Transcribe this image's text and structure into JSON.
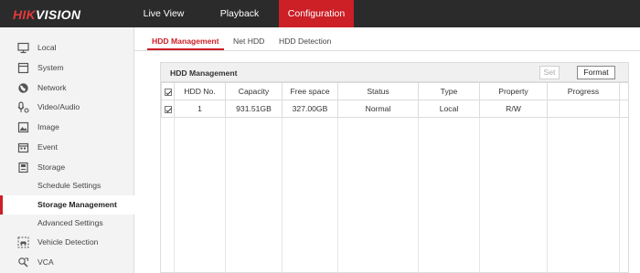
{
  "app": {
    "logo": {
      "part1": "HIK",
      "part2": "VISION"
    }
  },
  "nav": {
    "live_view": "Live View",
    "playback": "Playback",
    "configuration": "Configuration"
  },
  "sidebar": {
    "items": [
      {
        "label": "Local",
        "icon": "monitor-icon"
      },
      {
        "label": "System",
        "icon": "system-icon"
      },
      {
        "label": "Network",
        "icon": "network-globe-icon"
      },
      {
        "label": "Video/Audio",
        "icon": "microphone-icon"
      },
      {
        "label": "Image",
        "icon": "image-icon"
      },
      {
        "label": "Event",
        "icon": "calendar-icon"
      },
      {
        "label": "Storage",
        "icon": "storage-icon"
      }
    ],
    "storage_sub": [
      {
        "label": "Schedule Settings",
        "active": false
      },
      {
        "label": "Storage Management",
        "active": true
      },
      {
        "label": "Advanced Settings",
        "active": false
      }
    ],
    "more": [
      {
        "label": "Vehicle Detection",
        "icon": "vehicle-detection-icon"
      },
      {
        "label": "VCA",
        "icon": "vca-icon"
      }
    ]
  },
  "tabs": {
    "hdd_management": "HDD Management",
    "net_hdd": "Net HDD",
    "hdd_detection": "HDD Detection"
  },
  "panel": {
    "title": "HDD Management",
    "set_label": "Set",
    "format_label": "Format"
  },
  "table": {
    "headers": [
      "HDD No.",
      "Capacity",
      "Free space",
      "Status",
      "Type",
      "Property",
      "Progress"
    ],
    "rows": [
      {
        "checked": true,
        "hdd_no": "1",
        "capacity": "931.51GB",
        "free_space": "327.00GB",
        "status": "Normal",
        "type": "Local",
        "property": "R/W",
        "progress": ""
      }
    ]
  },
  "colors": {
    "accent": "#cc1f26",
    "topbar": "#2b2b2b",
    "sidebar_bg": "#f3f3f3"
  }
}
